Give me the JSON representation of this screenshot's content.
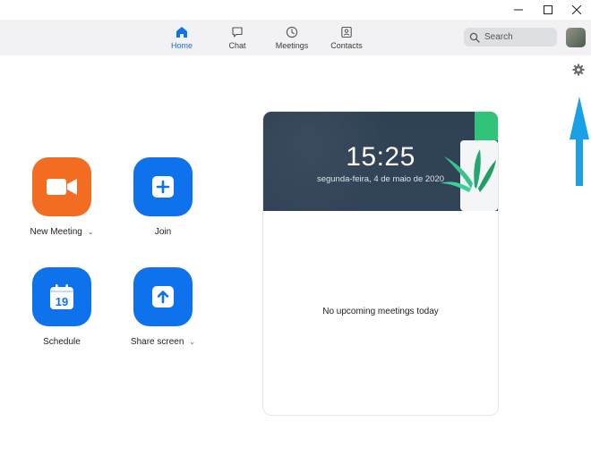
{
  "window": {
    "controls": [
      {
        "name": "minimize-icon"
      },
      {
        "name": "maximize-icon"
      },
      {
        "name": "close-icon"
      }
    ]
  },
  "nav": {
    "tabs": [
      {
        "label": "Home",
        "icon": "home-icon",
        "active": true
      },
      {
        "label": "Chat",
        "icon": "chat-bubble-icon",
        "active": false
      },
      {
        "label": "Meetings",
        "icon": "clock-icon",
        "active": false
      },
      {
        "label": "Contacts",
        "icon": "contact-card-icon",
        "active": false
      }
    ],
    "search_label": "Search"
  },
  "actions": [
    {
      "label": "New Meeting",
      "icon": "video-camera-icon",
      "color": "#f26d21",
      "has_dropdown": true
    },
    {
      "label": "Join",
      "icon": "plus-icon",
      "color": "#0e72ed",
      "has_dropdown": false
    },
    {
      "label": "Schedule",
      "icon": "calendar-icon",
      "calendar_day": "19",
      "color": "#0e72ed",
      "has_dropdown": false
    },
    {
      "label": "Share screen",
      "icon": "share-up-arrow-icon",
      "color": "#0e72ed",
      "has_dropdown": true
    }
  ],
  "card": {
    "time": "15:25",
    "date": "segunda-feira, 4 de maio de 2020",
    "empty_message": "No upcoming meetings today"
  },
  "colors": {
    "accent": "#0e72ed",
    "new_meeting": "#f26d21",
    "annotation_arrow": "#1aa0e6",
    "banner": "#2f4154"
  }
}
